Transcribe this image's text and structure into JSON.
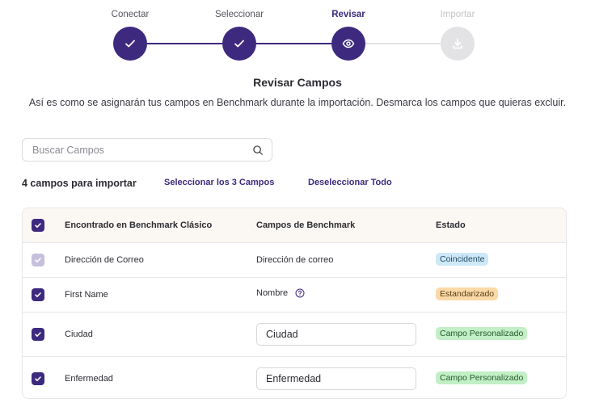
{
  "stepper": {
    "steps": [
      {
        "label": "Conectar",
        "state": "done",
        "icon": "check-icon"
      },
      {
        "label": "Seleccionar",
        "state": "done",
        "icon": "check-icon"
      },
      {
        "label": "Revisar",
        "state": "active",
        "icon": "eye-icon"
      },
      {
        "label": "Importar",
        "state": "pending",
        "icon": "download-icon"
      }
    ]
  },
  "page": {
    "title": "Revisar Campos",
    "subtitle": "Así es como se asignarán tus campos en Benchmark durante la importación. Desmarca los campos que quieras excluir."
  },
  "search": {
    "placeholder": "Buscar Campos",
    "value": ""
  },
  "summary": {
    "count_text": "4 campos para importar",
    "select_all_label": "Seleccionar los 3 Campos",
    "deselect_all_label": "Deseleccionar Todo"
  },
  "table": {
    "headers": {
      "found": "Encontrado en Benchmark Clásico",
      "fields": "Campos de Benchmark",
      "status": "Estado"
    },
    "rows": [
      {
        "found": "Dirección de Correo",
        "field": "Dirección de correo",
        "status": "Coincidente",
        "status_type": "match",
        "checked": true,
        "disabled": true,
        "editable": false,
        "help": false
      },
      {
        "found": "First Name",
        "field": "Nombre",
        "status": "Estandarizado",
        "status_type": "std",
        "checked": true,
        "disabled": false,
        "editable": false,
        "help": true
      },
      {
        "found": "Ciudad",
        "field": "Ciudad",
        "status": "Campo Personalizado",
        "status_type": "custom",
        "checked": true,
        "disabled": false,
        "editable": true,
        "help": false
      },
      {
        "found": "Enfermedad",
        "field": "Enfermedad",
        "status": "Campo Personalizado",
        "status_type": "custom",
        "checked": true,
        "disabled": false,
        "editable": true,
        "help": false
      }
    ]
  },
  "colors": {
    "accent": "#3d2a7f",
    "match": "#cde8f7",
    "standardized": "#fbd9a8",
    "custom": "#c2efc6"
  }
}
